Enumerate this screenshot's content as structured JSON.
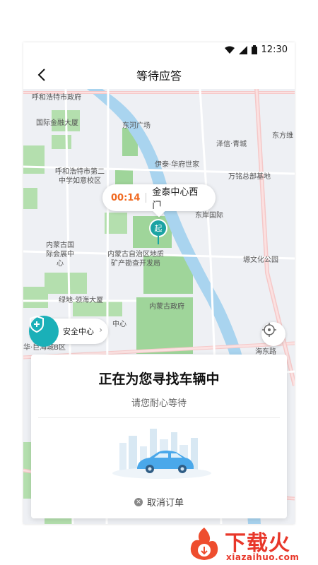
{
  "status": {
    "time": "12:30",
    "icons": [
      "wifi-icon",
      "signal-icon",
      "battery-icon"
    ]
  },
  "nav": {
    "title": "等待应答",
    "back_icon": "back-arrow-icon"
  },
  "map": {
    "labels": [
      {
        "id": "hhht-gov",
        "text": "呼和浩特市政府"
      },
      {
        "id": "intl-finance",
        "text": "国际金融大厦"
      },
      {
        "id": "donghe-square",
        "text": "东河广场"
      },
      {
        "id": "zefu-qingcheng",
        "text": "泽信·青城"
      },
      {
        "id": "dongfangwei",
        "text": "东方维"
      },
      {
        "id": "yitai-huafu",
        "text": "伊泰·华府世家"
      },
      {
        "id": "hhht-school",
        "text": "呼和浩特市第二中学如意校区"
      },
      {
        "id": "wanming",
        "text": "万铭总部基地"
      },
      {
        "id": "dongan-intl",
        "text": "东岸国际"
      },
      {
        "id": "nmg-intl-expo",
        "text": "内蒙古国际会展中心"
      },
      {
        "id": "nmg-mineral",
        "text": "内蒙古自治区地质矿产勘查开发局"
      },
      {
        "id": "yuanwenhua-park",
        "text": "塬文化公园"
      },
      {
        "id": "lvdi-linghai",
        "text": "绿地·领海大厦"
      },
      {
        "id": "nmg-gov",
        "text": "内蒙古政府"
      },
      {
        "id": "huayi-west",
        "text": "华·巨海城B区"
      },
      {
        "id": "hudong-center",
        "text": "中心"
      },
      {
        "id": "haidong-road",
        "text": "海东路"
      }
    ]
  },
  "bubble": {
    "timer": "00:14",
    "place": "金泰中心西门"
  },
  "pin": {
    "label": "起"
  },
  "safety": {
    "label": "安全中心",
    "arrow": "›"
  },
  "card": {
    "title": "正在为您寻找车辆中",
    "subtitle": "请您耐心等待",
    "cancel": "取消订单"
  },
  "brand": {
    "name": "下载火",
    "url": "xiazaihuo.com"
  },
  "colors": {
    "accent": "#1ab0b8",
    "timer": "#f06a22",
    "brand": "#e8372a",
    "river": "#a9d4ef",
    "park": "#9fd59a"
  }
}
